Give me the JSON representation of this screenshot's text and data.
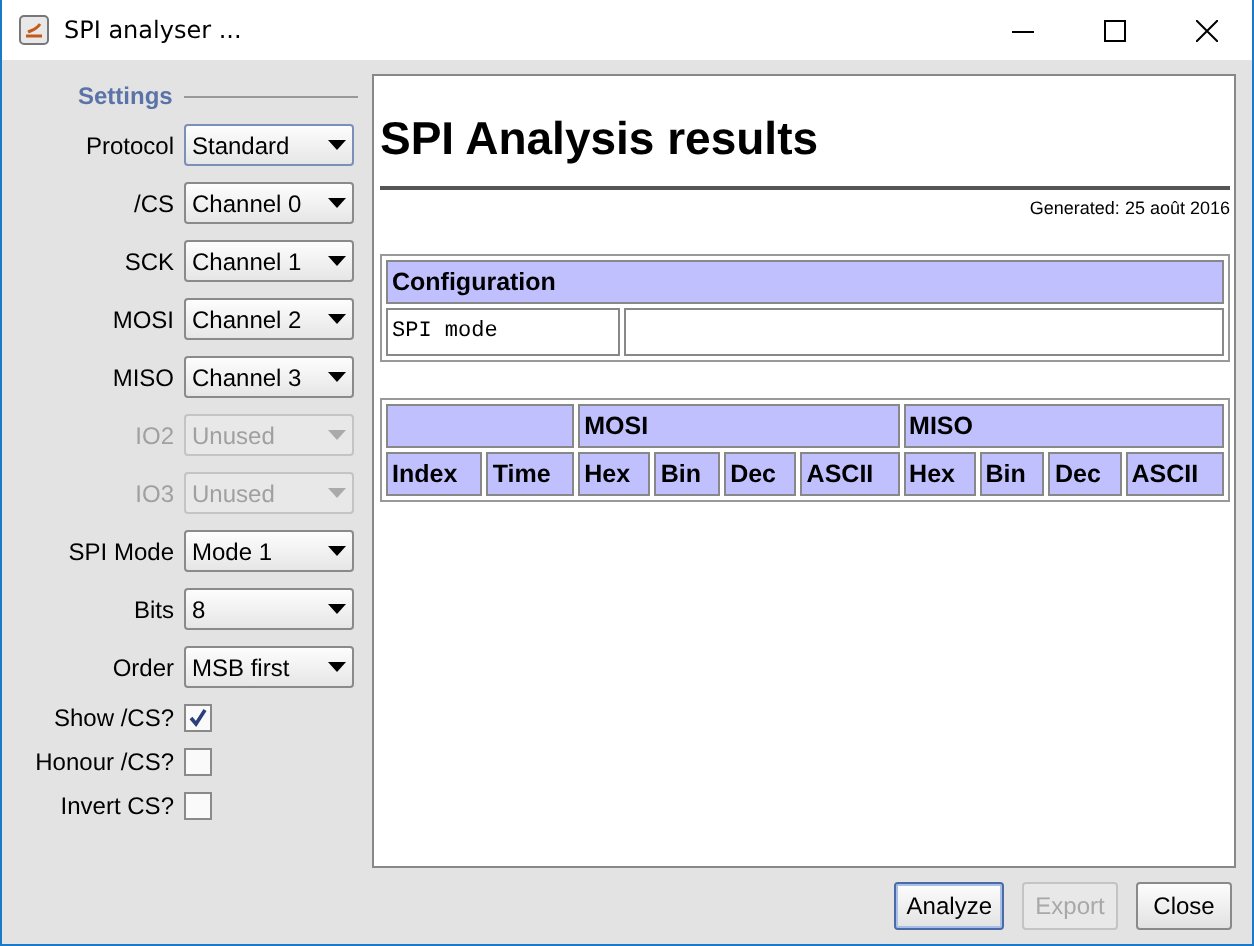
{
  "window": {
    "title": "SPI analyser ..."
  },
  "settings": {
    "heading": "Settings",
    "items": [
      {
        "kind": "select",
        "label": "Protocol",
        "value": "Standard",
        "disabled": false,
        "focused": true
      },
      {
        "kind": "select",
        "label": "/CS",
        "value": "Channel 0",
        "disabled": false,
        "focused": false
      },
      {
        "kind": "select",
        "label": "SCK",
        "value": "Channel 1",
        "disabled": false,
        "focused": false
      },
      {
        "kind": "select",
        "label": "MOSI",
        "value": "Channel 2",
        "disabled": false,
        "focused": false
      },
      {
        "kind": "select",
        "label": "MISO",
        "value": "Channel 3",
        "disabled": false,
        "focused": false
      },
      {
        "kind": "select",
        "label": "IO2",
        "value": "Unused",
        "disabled": true,
        "focused": false
      },
      {
        "kind": "select",
        "label": "IO3",
        "value": "Unused",
        "disabled": true,
        "focused": false
      },
      {
        "kind": "select",
        "label": "SPI Mode",
        "value": "Mode 1",
        "disabled": false,
        "focused": false
      },
      {
        "kind": "select",
        "label": "Bits",
        "value": "8",
        "disabled": false,
        "focused": false
      },
      {
        "kind": "select",
        "label": "Order",
        "value": "MSB first",
        "disabled": false,
        "focused": false
      },
      {
        "kind": "checkbox",
        "label": "Show /CS?",
        "checked": true
      },
      {
        "kind": "checkbox",
        "label": "Honour /CS?",
        "checked": false
      },
      {
        "kind": "checkbox",
        "label": "Invert CS?",
        "checked": false
      }
    ]
  },
  "report": {
    "title": "SPI Analysis results",
    "generated": "Generated: 25 août 2016",
    "configuration": {
      "heading": "Configuration",
      "rows": [
        {
          "name": "SPI mode"
        }
      ]
    },
    "data_table": {
      "groups": [
        {
          "label": "MOSI"
        },
        {
          "label": "MISO"
        }
      ],
      "columns": [
        "Index",
        "Time",
        "Hex",
        "Bin",
        "Dec",
        "ASCII",
        "Hex",
        "Bin",
        "Dec",
        "ASCII"
      ]
    }
  },
  "buttons": [
    {
      "label": "Analyze",
      "disabled": false,
      "default": true
    },
    {
      "label": "Export",
      "disabled": true,
      "default": false
    },
    {
      "label": "Close",
      "disabled": false,
      "default": false
    }
  ]
}
